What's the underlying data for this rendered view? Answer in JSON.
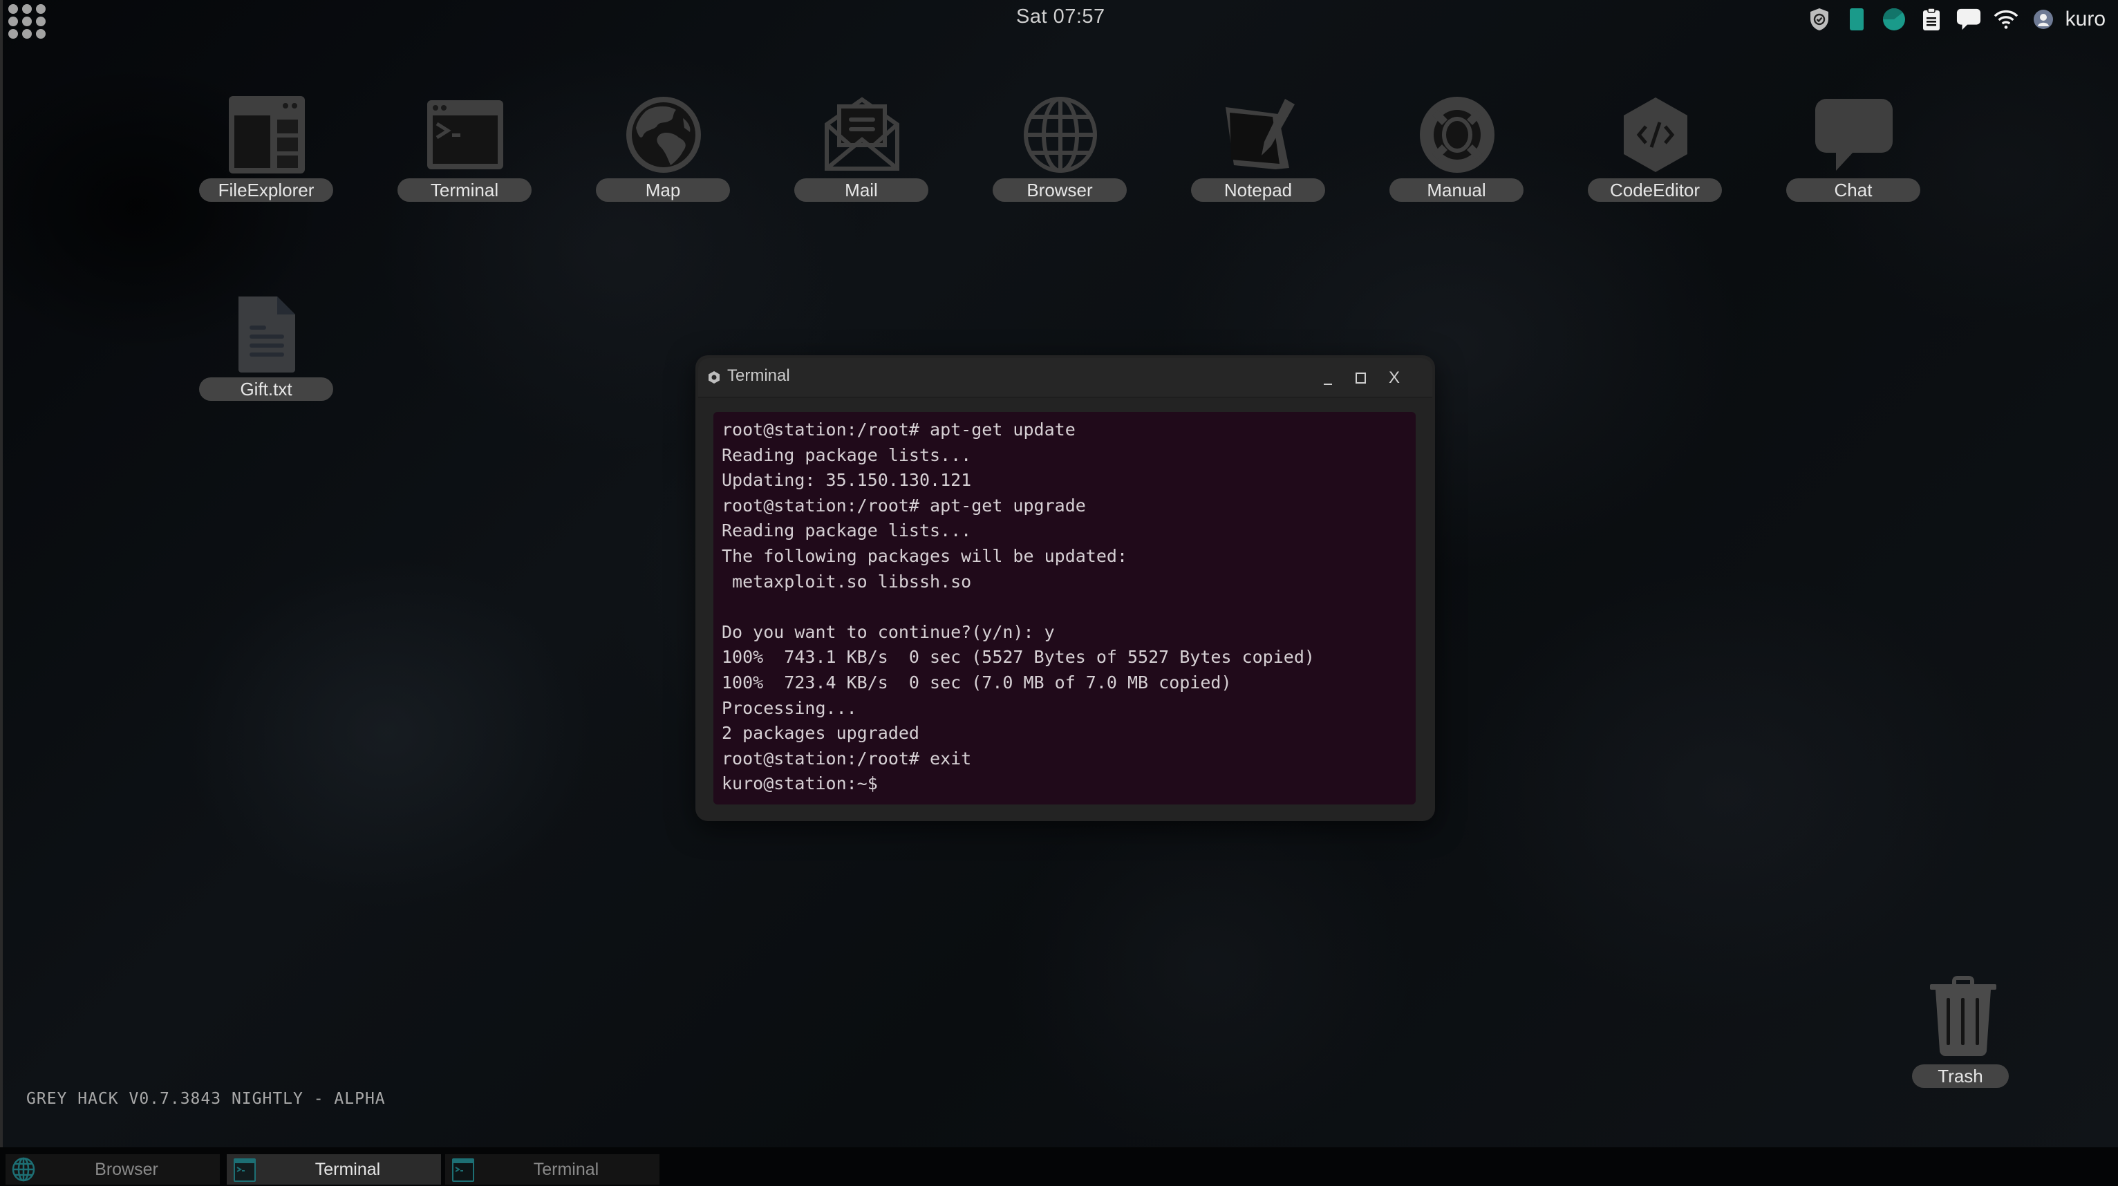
{
  "topbar": {
    "apps_menu_icon": "grid-dots-icon",
    "clock": "Sat 07:57",
    "tray": [
      {
        "name": "shield-check-icon",
        "color": "#bdbdbd"
      },
      {
        "name": "battery-icon",
        "color": "#1a9a8a"
      },
      {
        "name": "pie-chart-icon",
        "color": "#1a9a8a"
      },
      {
        "name": "clipboard-icon",
        "color": "#f2f2f2"
      },
      {
        "name": "chat-bubble-icon",
        "color": "#f2f2f2"
      },
      {
        "name": "wifi-icon",
        "color": "#f2f2f2"
      },
      {
        "name": "user-avatar-icon",
        "color": "#6e7a94"
      }
    ],
    "username": "kuro"
  },
  "desktop": {
    "icons": [
      {
        "label": "FileExplorer",
        "icon": "file-explorer-icon"
      },
      {
        "label": "Terminal",
        "icon": "terminal-icon"
      },
      {
        "label": "Map",
        "icon": "globe-map-icon"
      },
      {
        "label": "Mail",
        "icon": "mail-icon"
      },
      {
        "label": "Browser",
        "icon": "browser-globe-icon"
      },
      {
        "label": "Notepad",
        "icon": "notepad-icon"
      },
      {
        "label": "Manual",
        "icon": "lifebuoy-icon"
      },
      {
        "label": "CodeEditor",
        "icon": "code-editor-icon"
      },
      {
        "label": "Chat",
        "icon": "chat-icon"
      }
    ],
    "files": [
      {
        "label": "Gift.txt",
        "icon": "text-file-icon"
      }
    ],
    "trash": {
      "label": "Trash",
      "icon": "trash-icon"
    }
  },
  "terminal_window": {
    "title": "Terminal",
    "controls": {
      "minimize": "_",
      "maximize": "☐",
      "close": "X"
    },
    "lines": [
      "root@station:/root# apt-get update",
      "Reading package lists...",
      "Updating: 35.150.130.121",
      "root@station:/root# apt-get upgrade",
      "Reading package lists...",
      "The following packages will be updated:",
      " metaxploit.so libssh.so",
      "",
      "Do you want to continue?(y/n): y",
      "100%  743.1 KB/s  0 sec (5527 Bytes of 5527 Bytes copied)",
      "100%  723.4 KB/s  0 sec (7.0 MB of 7.0 MB copied)",
      "Processing...",
      "2 packages upgraded",
      "root@station:/root# exit",
      "kuro@station:~$"
    ],
    "colors": {
      "background": "#200a1a",
      "text": "#d6d0d4"
    }
  },
  "version_text": "GREY HACK V0.7.3843 NIGHTLY - ALPHA",
  "taskbar": {
    "items": [
      {
        "label": "Browser",
        "icon": "browser-globe-icon",
        "active": false
      },
      {
        "label": "Terminal",
        "icon": "terminal-icon",
        "active": true
      },
      {
        "label": "Terminal",
        "icon": "terminal-icon",
        "active": false
      }
    ],
    "accent": "#1d6f74"
  }
}
